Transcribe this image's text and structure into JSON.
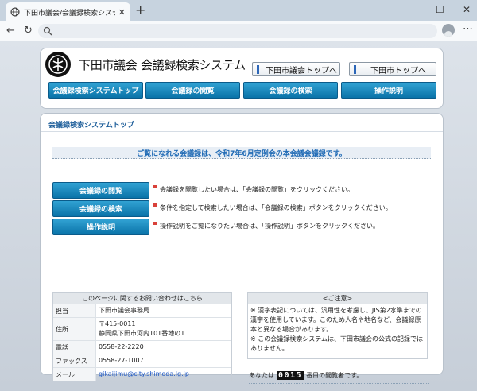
{
  "browser": {
    "tab_title": "下田市議会/会議録検索システム",
    "tab_close": "✕",
    "new_tab": "+",
    "window_controls": [
      "—",
      "☐",
      "✕"
    ],
    "nav": {
      "back": "←",
      "reload": "↻"
    },
    "menu": "⋯",
    "url_value": ""
  },
  "header": {
    "site_title": "下田市議会 会議録検索システム",
    "top_links": [
      "下田市議会トップへ",
      "下田市トップへ"
    ],
    "nav_buttons": [
      "会議録検索システムトップ",
      "会議録の閲覧",
      "会議録の検索",
      "操作説明"
    ]
  },
  "content": {
    "section_title": "会議録検索システムトップ",
    "notice": "ご覧になれる会議録は、令和7年6月定例会の本会議会議録です。",
    "actions": [
      {
        "label": "会議録の閲覧",
        "desc": "会議録を閲覧したい場合は、「会議録の閲覧」をクリックください。"
      },
      {
        "label": "会議録の検索",
        "desc": "条件を指定して検索したい場合は、「会議録の検索」ボタンをクリックください。"
      },
      {
        "label": "操作説明",
        "desc": "操作説明をご覧になりたい場合は、「操作説明」ボタンをクリックください。"
      }
    ],
    "contact": {
      "heading": "このページに関するお問い合わせはこちら",
      "rows": [
        {
          "label": "担当",
          "value": "下田市議会事務局"
        },
        {
          "label": "住所",
          "value": "〒415-0011\n静岡県下田市河内101番地の1"
        },
        {
          "label": "電話",
          "value": "0558-22-2220"
        },
        {
          "label": "ファックス",
          "value": "0558-27-1007"
        },
        {
          "label": "メール",
          "value": "gikaijimu@city.shimoda.lg.jp"
        }
      ]
    },
    "caution": {
      "heading": "<ご注意>",
      "text": "※ 漢字表記については、汎用性を考慮し、JIS第2水準までの漢字を使用しています。このため人名や地名など、会議録原本と異なる場合があります。\n※ この会議録検索システムは、下田市議会の公式の記録ではありません。"
    },
    "counter": {
      "prefix": "あなたは",
      "number": "0015",
      "suffix": "番目の閲覧者です。"
    }
  },
  "colors": {
    "nav_button": "#0a73a8",
    "section_title": "#1d5e9a",
    "notice_text": "#1f6ab5",
    "link": "#1a55c4",
    "marker": "#d9413a"
  },
  "icons": [
    "globe-icon",
    "back-arrow-icon",
    "reload-icon",
    "search-icon",
    "profile-icon",
    "more-menu-icon",
    "site-logo"
  ]
}
